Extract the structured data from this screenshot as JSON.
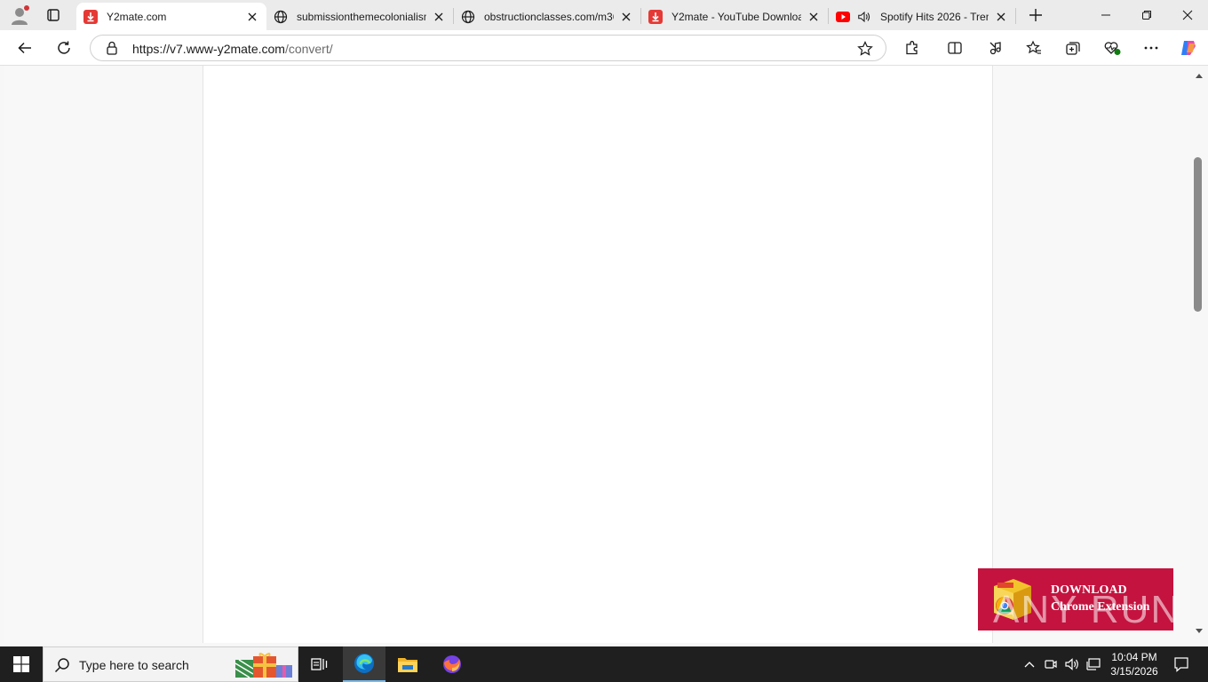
{
  "browser": {
    "tabs": [
      {
        "label": "Y2mate.com",
        "favicon": "y2mate-download-icon",
        "active": true
      },
      {
        "label": "submissionthemecolonialism",
        "favicon": "globe-icon",
        "active": false
      },
      {
        "label": "obstructionclasses.com/m36",
        "favicon": "globe-icon",
        "active": false
      },
      {
        "label": "Y2mate - YouTube Downloa",
        "favicon": "y2mate-download-icon",
        "active": false
      },
      {
        "label": "Spotify Hits 2026 - Tren",
        "favicon": "youtube-icon",
        "active": false,
        "audio": true
      }
    ],
    "address": {
      "host": "https://v7.www-y2mate.com",
      "path": "/convert/"
    }
  },
  "ad": {
    "line1": "DOWNLOAD",
    "line2": "Chrome Extension"
  },
  "watermark": "ANY RUN",
  "taskbar": {
    "search_placeholder": "Type here to search",
    "clock_time": "10:04 PM",
    "clock_date": "3/15/2026"
  },
  "colors": {
    "ad_bg": "#c4133f",
    "accent": "#0067c0",
    "y2mate_red": "#e53935"
  }
}
